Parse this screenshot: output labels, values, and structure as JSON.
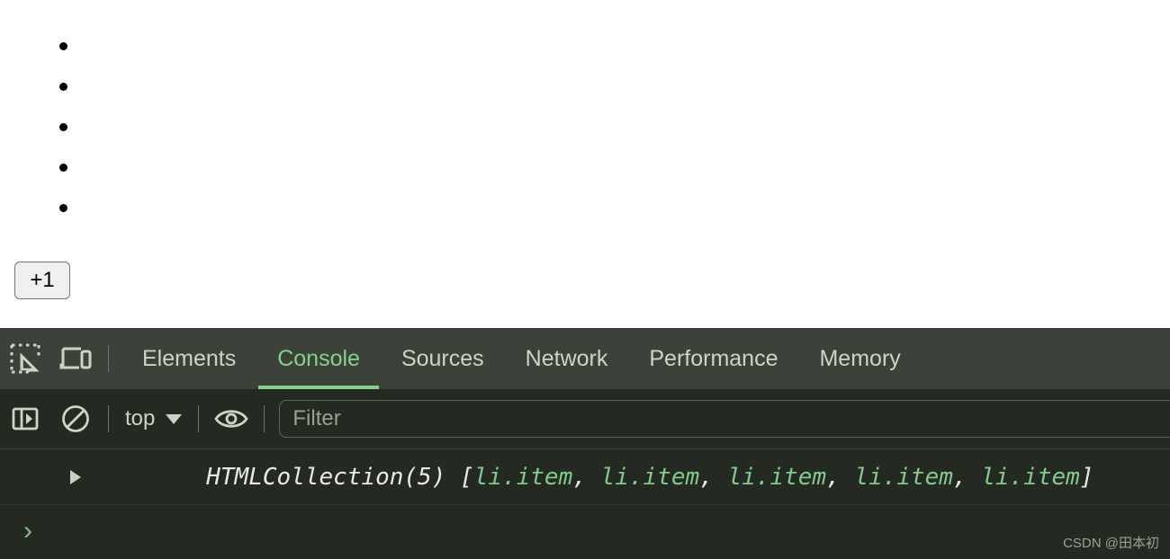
{
  "page": {
    "list_items": [
      "",
      "",
      "",
      "",
      ""
    ],
    "button_label": "+1"
  },
  "devtools": {
    "icons": {
      "inspect": "inspect-element-icon",
      "device": "device-toolbar-icon",
      "sidebar": "console-sidebar-icon",
      "clear": "clear-console-icon",
      "eye": "live-expression-eye-icon",
      "caret": "chevron-down-icon",
      "disclosure": "disclosure-triangle-icon",
      "prompt": "prompt-chevron-icon"
    },
    "tabs": [
      {
        "label": "Elements",
        "active": false
      },
      {
        "label": "Console",
        "active": true
      },
      {
        "label": "Sources",
        "active": false
      },
      {
        "label": "Network",
        "active": false
      },
      {
        "label": "Performance",
        "active": false
      },
      {
        "label": "Memory",
        "active": false
      }
    ],
    "console_toolbar": {
      "context": "top",
      "filter_placeholder": "Filter",
      "filter_value": ""
    },
    "console_output": {
      "prefix": "HTMLCollection(5) [",
      "tokens": [
        "li.item",
        "li.item",
        "li.item",
        "li.item",
        "li.item"
      ],
      "separator": ", ",
      "suffix": "]"
    },
    "prompt_symbol": "›",
    "watermark": "CSDN @田本初"
  },
  "colors": {
    "tabbar_bg": "#3c4139",
    "console_bg": "#242a22",
    "accent_green": "#84d18a",
    "token_green": "#82c98a",
    "text": "#cdd3c7"
  }
}
